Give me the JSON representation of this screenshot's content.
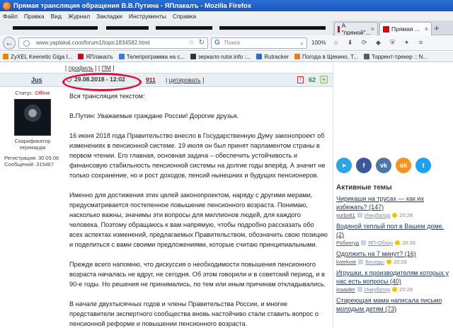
{
  "window": {
    "title": "Прямая трансляция обращения В.В.Путина - ЯПлакалъ - Mozilla Firefox"
  },
  "menu": [
    "Файл",
    "Правка",
    "Вид",
    "Журнал",
    "Закладки",
    "Инструменты",
    "Справка"
  ],
  "tabs": [
    {
      "label": "А \"пряной\"..."
    },
    {
      "label": "Прямая ..."
    }
  ],
  "nav": {
    "url": "www.yaplakal.com/forum1/topic1834582.html",
    "search_placeholder": "Поиск",
    "zoom": "100%"
  },
  "bookmarks": [
    {
      "label": "ZyXEL Keenetic Giga I...",
      "color": "#e08a00"
    },
    {
      "label": "ЯПлакалъ",
      "color": "#c01010"
    },
    {
      "label": "Телепрограмма на с...",
      "color": "#3a7bd5"
    },
    {
      "label": "зеркало rutor.info :...",
      "color": "#333333"
    },
    {
      "label": "Rutracker",
      "color": "#2b6cc4"
    },
    {
      "label": "Погода в Щекино, Т...",
      "color": "#e67e22"
    },
    {
      "label": "Торрент-трекер :: N...",
      "color": "#5a5a5a"
    }
  ],
  "forum": {
    "topnav": {
      "profile": "профиль",
      "pm": "ПМ"
    },
    "post": {
      "username": "Jus",
      "datetime": "29.08.2018 - 12:02",
      "number": "911",
      "quote_label": "цитировать",
      "rating": "62",
      "plus": "+"
    },
    "user": {
      "status_label": "Статус:",
      "status_value": "Offline",
      "title_line1": "Скарификатор",
      "title_line2": "перикарда",
      "reg": "Регистрация: 30.05.06",
      "msgs": "Сообщений: 315467"
    },
    "paragraphs": [
      "Вся трансляция текстом:",
      "В.Путин: Уважаемые граждане России! Дорогие друзья.",
      "16 июня 2018 года Правительство внесло в Государственную Думу законопроект об изменениях в пенсионной системе. 19 июля он был принят парламентом страны в первом чтении. Его главная, основная задача – обеспечить устойчивость и финансовую стабильность пенсионной системы на долгие годы вперёд. А значит не только сохранение, но и рост доходов, пенсий нынешних и будущих пенсионеров.",
      "Именно для достижения этих целей законопроектом, наряду с другими мерами, предусматривается постепенное повышение пенсионного возраста. Понимаю, насколько важны, значимы эти вопросы для миллионов людей, для каждого человека. Поэтому обращаюсь к вам напрямую, чтобы подробно рассказать обо всех аспектах изменений, предлагаемых Правительством, обозначить свою позицию и поделиться с вами своими предложениями, которые считаю принципиальными.",
      "Прежде всего напомню, что дискуссия о необходимости повышения пенсионного возраста началась не вдруг, не сегодня. Об этом говорили и в советский период, и в 90-е годы. Но решения не принимались, по тем или иным причинам откладывались.",
      "В начале двухтысячных годов и члены Правительства России, и многие представители экспертного сообщества вновь настойчиво стали ставить вопрос о пенсионной реформе и повышении пенсионного возраста."
    ]
  },
  "sidebar": {
    "socials": [
      {
        "name": "telegram",
        "glyph": "➤",
        "color": "#2ca5e0"
      },
      {
        "name": "facebook",
        "glyph": "f",
        "color": "#3b5998"
      },
      {
        "name": "vk",
        "glyph": "vk",
        "color": "#4a76a8"
      },
      {
        "name": "odnoklassniki",
        "glyph": "ok",
        "color": "#f7931e"
      },
      {
        "name": "twitter",
        "glyph": "t",
        "color": "#1da1f2"
      }
    ],
    "active_title": "Активные темы",
    "topics": [
      {
        "title": "Чирикаши на трусах — как их избежать?",
        "count": "(147)",
        "user": "yurbv81",
        "category": "Инкубатор",
        "time": "20:28"
      },
      {
        "title": "Водяной теплый пол в Вашем доме.",
        "count": "(2)",
        "user": "Робингуд",
        "category": "ЯП-Обзор",
        "time": "20:28"
      },
      {
        "title": "Одолжить на 7 минут?",
        "count": "(16)",
        "user": "kotekote",
        "category": "Беседы",
        "time": "20:28"
      },
      {
        "title": "Игрушки, к производителям которых у нас есть вопросы",
        "count": "(40)",
        "user": "inaaider",
        "category": "Инкубатор",
        "time": "20:28"
      },
      {
        "title": "Стареющая мама написала письмо молодым детям",
        "count": "(73)",
        "user": "",
        "category": "",
        "time": ""
      }
    ]
  }
}
